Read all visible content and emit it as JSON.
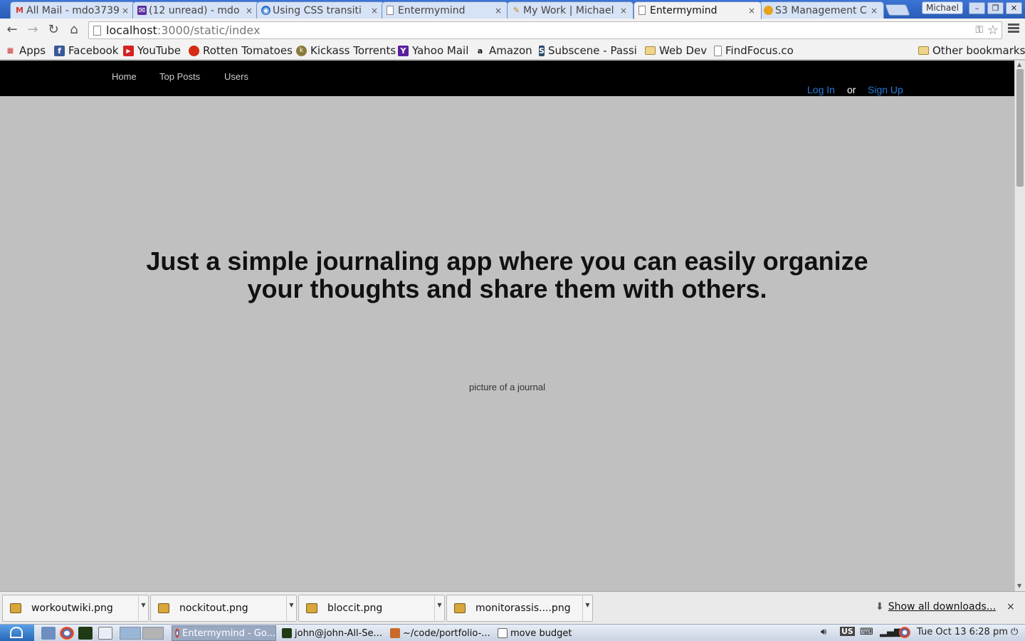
{
  "browser": {
    "tabs": [
      {
        "title": "All Mail - mdo3739",
        "icon": "gmail-icon"
      },
      {
        "title": "(12 unread) - mdo",
        "icon": "yahoo-mail-icon"
      },
      {
        "title": "Using CSS transiti",
        "icon": "mdn-icon"
      },
      {
        "title": "Entermymind",
        "icon": "page-icon"
      },
      {
        "title": "My Work | Michael",
        "icon": "pencil-icon"
      },
      {
        "title": "Entermymind",
        "icon": "page-icon",
        "active": true
      },
      {
        "title": "S3 Management C",
        "icon": "aws-icon"
      }
    ],
    "tab_close_glyph": "×",
    "profile_name": "Michael",
    "window_buttons": [
      "–",
      "❐",
      "✕"
    ],
    "url_host": "localhost",
    "url_rest": ":3000/static/index",
    "bookmarks": [
      {
        "label": "Apps",
        "icon": "apps-grid-icon"
      },
      {
        "label": "Facebook",
        "icon": "facebook-icon"
      },
      {
        "label": "YouTube",
        "icon": "youtube-icon"
      },
      {
        "label": "Rotten Tomatoes",
        "icon": "tomato-icon"
      },
      {
        "label": "Kickass Torrents",
        "icon": "kickass-icon"
      },
      {
        "label": "Yahoo Mail",
        "icon": "yahoo-icon"
      },
      {
        "label": "Amazon",
        "icon": "amazon-icon"
      },
      {
        "label": "Subscene - Passio",
        "icon": "subscene-icon"
      },
      {
        "label": "Web Dev",
        "icon": "folder-icon"
      },
      {
        "label": "FindFocus.co",
        "icon": "page-icon"
      }
    ],
    "other_bookmarks": "Other bookmarks"
  },
  "site": {
    "nav": {
      "home": "Home",
      "top_posts": "Top Posts",
      "users": "Users"
    },
    "auth": {
      "login": "Log In",
      "or": "or",
      "signup": "Sign Up"
    },
    "hero_text": "Just a simple journaling app where you can easily organize your thoughts and share them with others.",
    "image_alt": "picture of a journal",
    "colors": {
      "navbar": "#000000",
      "background": "#c0c0c0",
      "link": "#2a7ad8"
    }
  },
  "downloads": {
    "items": [
      "workoutwiki.png",
      "nockitout.png",
      "bloccit.png",
      "monitorassis....png"
    ],
    "show_all": "Show all downloads...",
    "close": "×"
  },
  "taskbar": {
    "tasks": [
      {
        "label": "Entermymind - Go...",
        "active": true
      },
      {
        "label": "john@john-All-Se..."
      },
      {
        "label": "~/code/portfolio-..."
      },
      {
        "label": "move budget"
      }
    ],
    "keyboard_layout": "US",
    "clock": "Tue Oct 13   6:28 pm"
  }
}
